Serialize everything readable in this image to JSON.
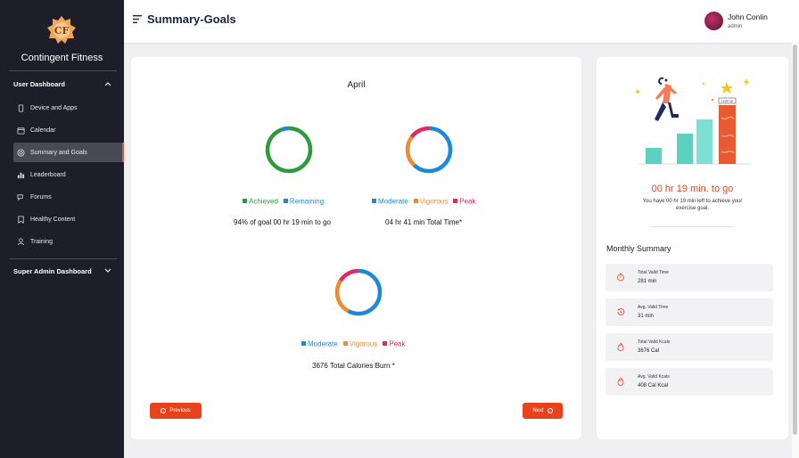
{
  "brand": {
    "name": "Contingent Fitness"
  },
  "sidebar": {
    "section_user": "User Dashboard",
    "items": [
      {
        "label": "Device and Apps"
      },
      {
        "label": "Calendar"
      },
      {
        "label": "Summary and Goals",
        "active": true
      },
      {
        "label": "Leaderboard"
      },
      {
        "label": "Forums"
      },
      {
        "label": "Healthy Content"
      },
      {
        "label": "Training"
      }
    ],
    "section_admin": "Super Admin Dashboard"
  },
  "header": {
    "title": "Summary-Goals",
    "user_name": "John Conlin",
    "user_role": "admin"
  },
  "main": {
    "month": "April",
    "charts": [
      {
        "legend": [
          "Achieved",
          "Remaining"
        ],
        "colors": [
          "#2e9a3e",
          "#1e88d8"
        ],
        "values": [
          94,
          6
        ],
        "caption": "94% of goal 00 hr 19 min to go"
      },
      {
        "legend": [
          "Moderate",
          "Vigorous",
          "Peak"
        ],
        "colors": [
          "#1e88d8",
          "#f08a2e",
          "#e02a5e"
        ],
        "values": [
          62,
          23,
          15
        ],
        "caption": "04 hr 41 min Total Time*"
      },
      {
        "legend": [
          "Moderate",
          "Vigorous",
          "Peak"
        ],
        "colors": [
          "#1e88d8",
          "#f08a2e",
          "#e02a5e"
        ],
        "values": [
          58,
          26,
          16
        ],
        "caption": "3676 Total Calories Burn *"
      }
    ],
    "prev_label": "Previous",
    "next_label": "Next"
  },
  "goal": {
    "time_left": "00 hr 19 min. to go",
    "sub": "You have 00 hr 19 min left to achieve your exercise goal.",
    "level_badge": "Level up"
  },
  "monthly_summary": {
    "title": "Monthly Summary",
    "stats": [
      {
        "label": "Total Valid Time",
        "value": "281 min"
      },
      {
        "label": "Avg. Valid Time",
        "value": "31 min"
      },
      {
        "label": "Total Valid Kcals",
        "value": "3676 Cal"
      },
      {
        "label": "Avg. Valid Kcals",
        "value": "408 Cal Kcal"
      }
    ]
  },
  "accent": "#e8421c"
}
